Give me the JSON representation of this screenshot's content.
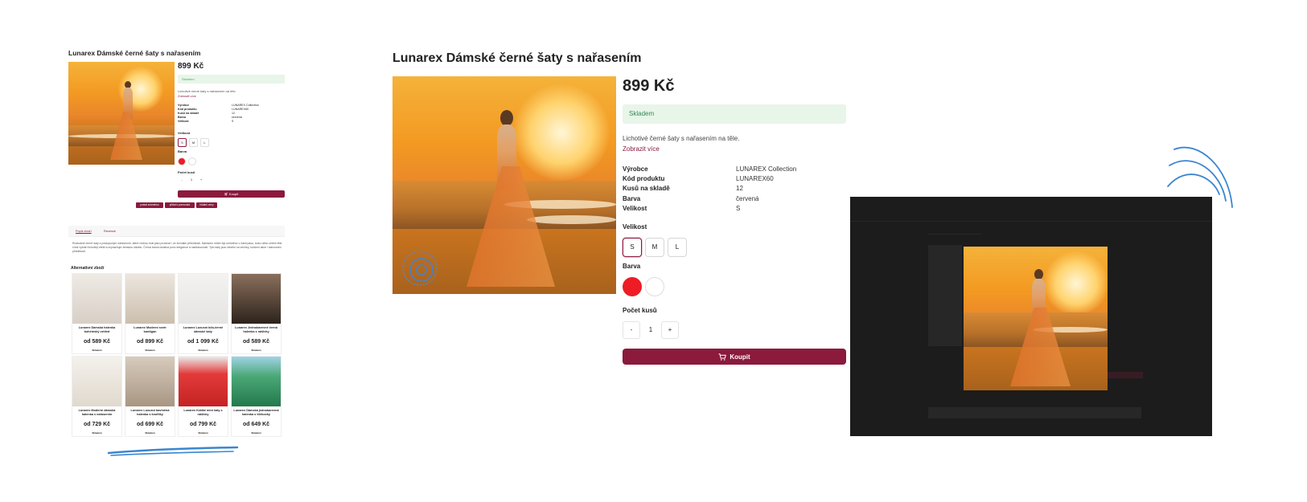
{
  "product": {
    "title": "Lunarex Dámské černé šaty s nařasením",
    "price": "899 Kč",
    "stock": "Skladem",
    "description": "Lichotivé černé šaty s nařasením na těle.",
    "show_more": "Zobrazit více",
    "specs": [
      {
        "label": "Výrobce",
        "value": "LUNAREX Collection"
      },
      {
        "label": "Kód produktu",
        "value": "LUNAREX60"
      },
      {
        "label": "Kusů na skladě",
        "value": "12"
      },
      {
        "label": "Barva",
        "value": "červená"
      },
      {
        "label": "Velikost",
        "value": "S"
      }
    ],
    "size_label": "Velikost",
    "sizes": [
      "S",
      "M",
      "L"
    ],
    "selected_size": "S",
    "color_label": "Barva",
    "colors": [
      "#ee1c25",
      "#ffffff"
    ],
    "quantity_label": "Počet kusů",
    "quantity": "1",
    "qty_minus": "-",
    "qty_plus": "+",
    "buy_label": "Koupit"
  },
  "mini": {
    "actions": [
      "poslat známému",
      "přidat k porovnání",
      "hlídání ceny"
    ],
    "tabs": [
      "Popis zboží",
      "Recenze"
    ],
    "paragraph": "Rozkošné černé šaty s postupovým nařasením, které mohou hrát jako pruhově i ve formální příležitosti. Nařasení může být umístěno v části pasu, boku nebo celém těle, čímž vytváří lichotivý efekt a zvýrazňuje ženskou siluetu. Černá barva dodává punc elegance a nadčasovosti. Tyto šaty jsou ideální na večírky, kulturní akce i slavnostní příležitosti.",
    "alt_title": "Alternativní zboží",
    "stock_small": "Skladem",
    "cards": [
      {
        "name": "Lunarex Dámská halenka bohémský vzhled",
        "price": "od 589 Kč",
        "bg": "#d8cfc6"
      },
      {
        "name": "Lunarex Moderní svetr kardigan",
        "price": "od 899 Kč",
        "bg": "#cbbfae"
      },
      {
        "name": "Lunarex Luxusní bílo-černé dámské šaty",
        "price": "od 1 099 Kč",
        "bg": "#e6e4e2"
      },
      {
        "name": "Lunarex Jednobarevné černá halenka s nášivky",
        "price": "od 589 Kč",
        "bg": "#4b3a2f"
      },
      {
        "name": "Lunarex Moderní dámská halenka s nařasením",
        "price": "od 729 Kč",
        "bg": "#e8e3da"
      },
      {
        "name": "Lunarex Luxusní bavlněná halenka s knoflíky",
        "price": "od 699 Kč",
        "bg": "#c2b29e"
      },
      {
        "name": "Lunarex Krátké mini šaty s nášivky",
        "price": "od 799 Kč",
        "bg": "#d93b3b"
      },
      {
        "name": "Lunarex Dámská jednobarevná halenka s tričkovky",
        "price": "od 649 Kč",
        "bg": "#2f8a5b"
      }
    ]
  },
  "colors": {
    "accent": "#8b1a3d",
    "stock_bg": "#e8f5e9",
    "stock_text": "#2e8b57",
    "annotation": "#3a86d0"
  },
  "icons": {
    "cart": "cart-icon",
    "target": "target-icon"
  }
}
